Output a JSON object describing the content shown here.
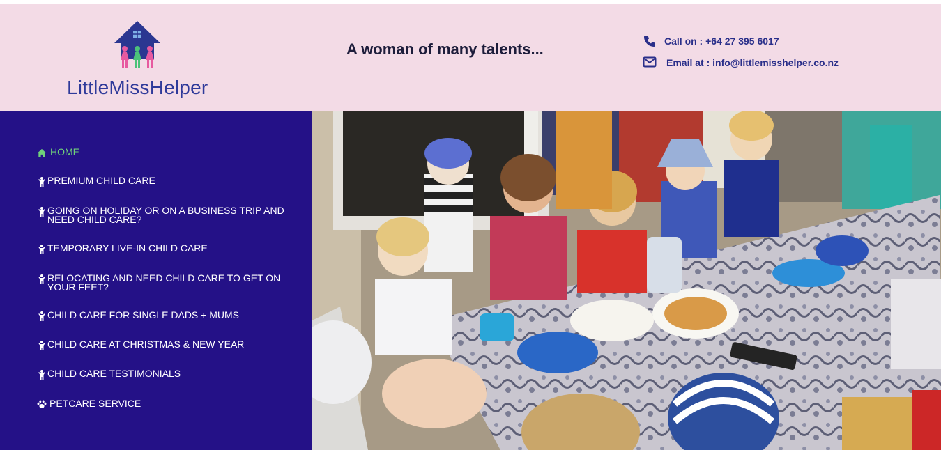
{
  "header": {
    "logo_text": "LittleMissHelper",
    "tagline": "A woman of many talents...",
    "contact": {
      "phone_label": "Call on : +64 27 395 6017",
      "email_label": "Email at : info@littlemisshelper.co.nz"
    }
  },
  "nav": {
    "items": [
      {
        "label": "HOME",
        "icon": "home-icon"
      },
      {
        "label": "PREMIUM CHILD CARE",
        "icon": "child-icon"
      },
      {
        "label": "GOING ON HOLIDAY OR ON A BUSINESS TRIP AND NEED CHILD CARE?",
        "icon": "child-icon"
      },
      {
        "label": "TEMPORARY LIVE-IN CHILD CARE",
        "icon": "child-icon"
      },
      {
        "label": "RELOCATING AND NEED CHILD CARE TO GET ON YOUR FEET?",
        "icon": "child-icon"
      },
      {
        "label": "CHILD CARE FOR SINGLE DADS + MUMS",
        "icon": "child-icon"
      },
      {
        "label": "CHILD CARE AT CHRISTMAS & NEW YEAR",
        "icon": "child-icon"
      },
      {
        "label": "CHILD CARE TESTIMONIALS",
        "icon": "child-icon"
      },
      {
        "label": "PETCARE SERVICE",
        "icon": "paw-icon"
      }
    ]
  },
  "colors": {
    "header_bg": "#f3dbe6",
    "sidebar_bg": "#241187",
    "active_nav": "#6fd07a",
    "brand_blue": "#2f3a9a"
  }
}
